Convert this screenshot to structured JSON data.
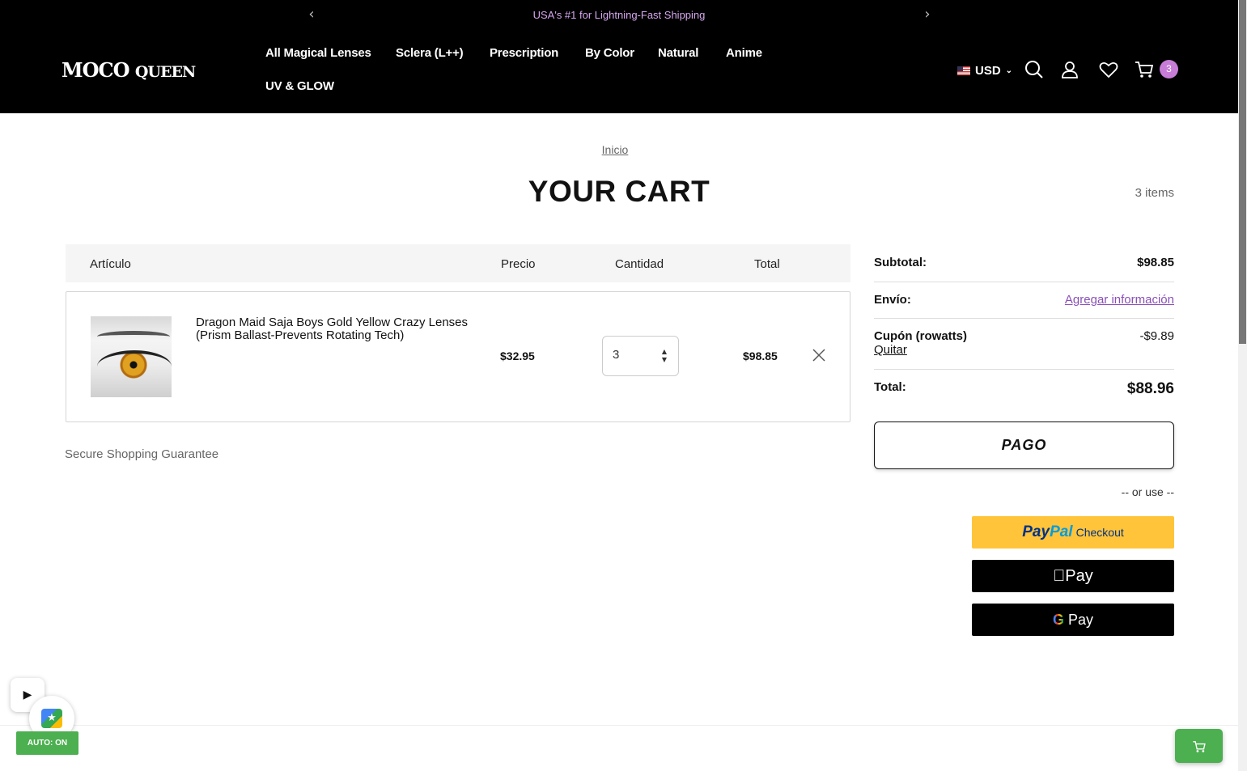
{
  "announcement": {
    "text": "USA's #1 for Lightning-Fast Shipping",
    "prev_icon": "chevron-left-icon",
    "next_icon": "chevron-right-icon"
  },
  "header": {
    "logo_main": "MOCO",
    "logo_secondary": "QUEEN",
    "nav": [
      {
        "label": "All Magical Lenses"
      },
      {
        "label": "Sclera (L++)"
      },
      {
        "label": "Prescription"
      },
      {
        "label": "By Color"
      },
      {
        "label": "Natural"
      },
      {
        "label": "Anime"
      },
      {
        "label": "UV & GLOW"
      }
    ],
    "currency": "USD",
    "cart_count": "3",
    "icons": [
      "search-icon",
      "user-icon",
      "heart-icon",
      "cart-icon"
    ]
  },
  "breadcrumb": "Inicio",
  "page_title": "YOUR CART",
  "items_count": "3 items",
  "table": {
    "headers": {
      "item": "Artículo",
      "price": "Precio",
      "quantity": "Cantidad",
      "total": "Total"
    },
    "rows": [
      {
        "name": "Dragon Maid Saja Boys Gold Yellow Crazy Lenses (Prism Ballast-Prevents Rotating Tech)",
        "price": "$32.95",
        "quantity": "3",
        "total": "$98.85"
      }
    ]
  },
  "secure_text": "Secure Shopping Guarantee",
  "summary": {
    "subtotal_label": "Subtotal:",
    "subtotal_value": "$98.85",
    "shipping_label": "Envío:",
    "shipping_link": "Agregar información",
    "coupon_label": "Cupón (rowatts)",
    "coupon_value": "-$9.89",
    "coupon_remove": "Quitar",
    "total_label": "Total:",
    "total_value": "$88.96",
    "checkout_label": "PAGO",
    "or_use": "-- or use --",
    "paypal_pay": "Pay",
    "paypal_pal": "Pal",
    "paypal_checkout": "Checkout",
    "applepay_label": "Pay",
    "gpay_label": "Pay",
    "gpay_g": "G"
  },
  "widgets": {
    "auto_label": "AUTO: ON"
  },
  "colors": {
    "header_bg": "#000000",
    "announce_text": "#d7a7f0",
    "cart_badge": "#c77dd8",
    "link_purple": "#8a4fb8",
    "paypal_yellow": "#ffc439",
    "widget_green": "#4caf50"
  }
}
